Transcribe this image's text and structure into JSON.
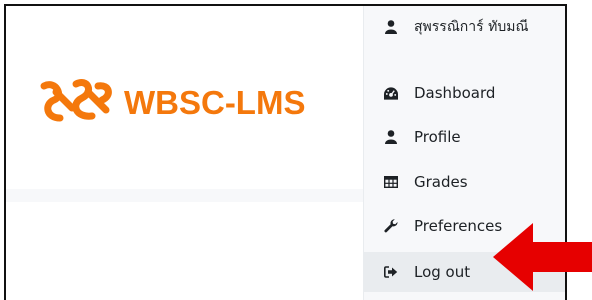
{
  "brand": {
    "logo_text": "WBSC-LMS",
    "color": "#f4780c"
  },
  "user_menu": {
    "username": "สุพรรณิการ์ ทับมณี",
    "items": [
      {
        "label": "Dashboard",
        "icon": "dashboard-icon"
      },
      {
        "label": "Profile",
        "icon": "user-icon"
      },
      {
        "label": "Grades",
        "icon": "grid-table-icon"
      },
      {
        "label": "Preferences",
        "icon": "wrench-icon"
      },
      {
        "label": "Log out",
        "icon": "sign-out-icon"
      }
    ]
  },
  "annotation": {
    "arrow_color": "#e60000",
    "points_to": "Log out"
  }
}
